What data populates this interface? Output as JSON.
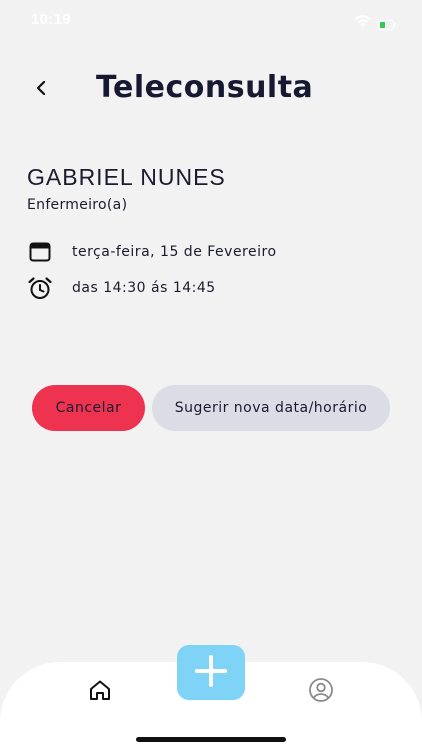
{
  "status_bar": {
    "time": "10:19",
    "wifi_icon": "wifi-icon",
    "battery_icon": "battery-icon",
    "battery_color": "#34c759"
  },
  "header": {
    "back_icon": "chevron-left-icon",
    "title": "Teleconsulta"
  },
  "professional": {
    "name": "GABRIEL NUNES",
    "role": "Enfermeiro(a)"
  },
  "appointment": {
    "date_icon": "calendar-icon",
    "date_text": "terça-feira, 15 de Fevereiro",
    "time_icon": "alarm-clock-icon",
    "time_text": "das 14:30 ás 14:45"
  },
  "actions": {
    "cancel_label": "Cancelar",
    "suggest_label": "Sugerir nova data/horário"
  },
  "tab_bar": {
    "home_icon": "home-icon",
    "add_icon": "plus-icon",
    "profile_icon": "user-circle-icon"
  },
  "colors": {
    "background": "#f2f2f2",
    "title": "#171933",
    "cancel": "#ee3350",
    "suggest": "#dcdce6",
    "fab": "#7fd3f7"
  }
}
